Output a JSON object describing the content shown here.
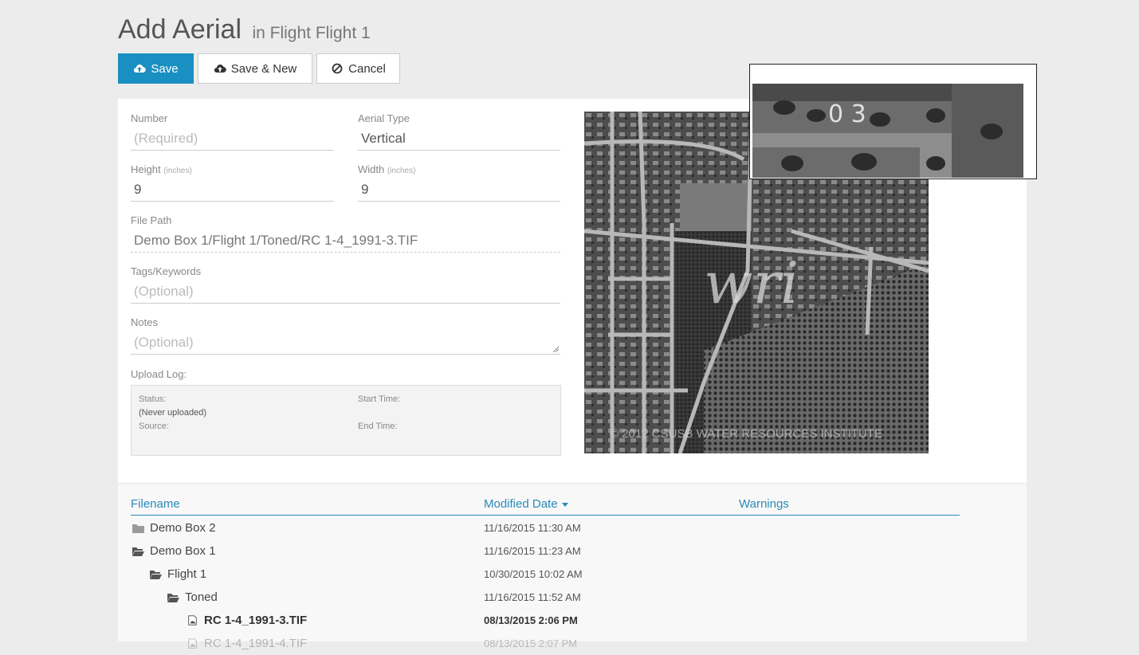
{
  "header": {
    "title": "Add Aerial",
    "subtitle": "in Flight Flight 1"
  },
  "toolbar": {
    "save_label": "Save",
    "save_new_label": "Save & New",
    "cancel_label": "Cancel"
  },
  "colors": {
    "primary": "#1a8fc2",
    "link": "#2a8ab9"
  },
  "form": {
    "number": {
      "label": "Number",
      "placeholder": "(Required)"
    },
    "aerial_type": {
      "label": "Aerial Type",
      "value": "Vertical"
    },
    "height": {
      "label": "Height",
      "unit": "(inches)",
      "value": "9"
    },
    "width": {
      "label": "Width",
      "unit": "(inches)",
      "value": "9"
    },
    "file_path": {
      "label": "File Path",
      "value": "Demo Box 1/Flight 1/Toned/RC 1-4_1991-3.TIF"
    },
    "tags": {
      "label": "Tags/Keywords",
      "placeholder": "(Optional)"
    },
    "notes": {
      "label": "Notes",
      "placeholder": "(Optional)"
    }
  },
  "upload_log": {
    "label": "Upload Log:",
    "status_label": "Status:",
    "status_value": "(Never uploaded)",
    "source_label": "Source:",
    "start_label": "Start Time:",
    "end_label": "End Time:"
  },
  "preview": {
    "watermark": "wri",
    "copyright": "© 2012 CSUSB WATER RESOURCES INSTITUTE",
    "zoom_text": "0 3"
  },
  "file_list": {
    "columns": {
      "filename": "Filename",
      "modified": "Modified Date",
      "warnings": "Warnings"
    },
    "rows": [
      {
        "name": "Demo Box 2",
        "date": "11/16/2015 11:30 AM",
        "icon": "folder-icon"
      },
      {
        "name": "Demo Box 1",
        "date": "11/16/2015 11:23 AM",
        "icon": "folder-open-icon"
      },
      {
        "name": "Flight 1",
        "date": "10/30/2015 10:02 AM",
        "icon": "folder-open-icon"
      },
      {
        "name": "Toned",
        "date": "11/16/2015 11:52 AM",
        "icon": "folder-open-icon"
      },
      {
        "name": "RC 1-4_1991-3.TIF",
        "date": "08/13/2015 2:06 PM",
        "icon": "image-file-icon"
      },
      {
        "name": "RC 1-4_1991-4.TIF",
        "date": "08/13/2015 2:07 PM",
        "icon": "image-file-icon"
      }
    ]
  }
}
